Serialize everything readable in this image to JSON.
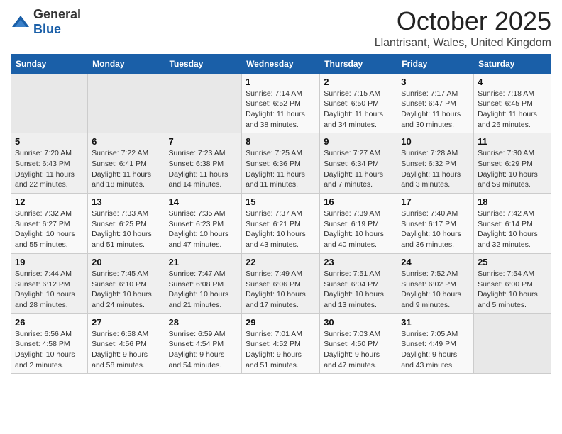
{
  "header": {
    "logo_general": "General",
    "logo_blue": "Blue",
    "title": "October 2025",
    "subtitle": "Llantrisant, Wales, United Kingdom"
  },
  "weekdays": [
    "Sunday",
    "Monday",
    "Tuesday",
    "Wednesday",
    "Thursday",
    "Friday",
    "Saturday"
  ],
  "weeks": [
    [
      {
        "day": "",
        "info": ""
      },
      {
        "day": "",
        "info": ""
      },
      {
        "day": "",
        "info": ""
      },
      {
        "day": "1",
        "info": "Sunrise: 7:14 AM\nSunset: 6:52 PM\nDaylight: 11 hours and 38 minutes."
      },
      {
        "day": "2",
        "info": "Sunrise: 7:15 AM\nSunset: 6:50 PM\nDaylight: 11 hours and 34 minutes."
      },
      {
        "day": "3",
        "info": "Sunrise: 7:17 AM\nSunset: 6:47 PM\nDaylight: 11 hours and 30 minutes."
      },
      {
        "day": "4",
        "info": "Sunrise: 7:18 AM\nSunset: 6:45 PM\nDaylight: 11 hours and 26 minutes."
      }
    ],
    [
      {
        "day": "5",
        "info": "Sunrise: 7:20 AM\nSunset: 6:43 PM\nDaylight: 11 hours and 22 minutes."
      },
      {
        "day": "6",
        "info": "Sunrise: 7:22 AM\nSunset: 6:41 PM\nDaylight: 11 hours and 18 minutes."
      },
      {
        "day": "7",
        "info": "Sunrise: 7:23 AM\nSunset: 6:38 PM\nDaylight: 11 hours and 14 minutes."
      },
      {
        "day": "8",
        "info": "Sunrise: 7:25 AM\nSunset: 6:36 PM\nDaylight: 11 hours and 11 minutes."
      },
      {
        "day": "9",
        "info": "Sunrise: 7:27 AM\nSunset: 6:34 PM\nDaylight: 11 hours and 7 minutes."
      },
      {
        "day": "10",
        "info": "Sunrise: 7:28 AM\nSunset: 6:32 PM\nDaylight: 11 hours and 3 minutes."
      },
      {
        "day": "11",
        "info": "Sunrise: 7:30 AM\nSunset: 6:29 PM\nDaylight: 10 hours and 59 minutes."
      }
    ],
    [
      {
        "day": "12",
        "info": "Sunrise: 7:32 AM\nSunset: 6:27 PM\nDaylight: 10 hours and 55 minutes."
      },
      {
        "day": "13",
        "info": "Sunrise: 7:33 AM\nSunset: 6:25 PM\nDaylight: 10 hours and 51 minutes."
      },
      {
        "day": "14",
        "info": "Sunrise: 7:35 AM\nSunset: 6:23 PM\nDaylight: 10 hours and 47 minutes."
      },
      {
        "day": "15",
        "info": "Sunrise: 7:37 AM\nSunset: 6:21 PM\nDaylight: 10 hours and 43 minutes."
      },
      {
        "day": "16",
        "info": "Sunrise: 7:39 AM\nSunset: 6:19 PM\nDaylight: 10 hours and 40 minutes."
      },
      {
        "day": "17",
        "info": "Sunrise: 7:40 AM\nSunset: 6:17 PM\nDaylight: 10 hours and 36 minutes."
      },
      {
        "day": "18",
        "info": "Sunrise: 7:42 AM\nSunset: 6:14 PM\nDaylight: 10 hours and 32 minutes."
      }
    ],
    [
      {
        "day": "19",
        "info": "Sunrise: 7:44 AM\nSunset: 6:12 PM\nDaylight: 10 hours and 28 minutes."
      },
      {
        "day": "20",
        "info": "Sunrise: 7:45 AM\nSunset: 6:10 PM\nDaylight: 10 hours and 24 minutes."
      },
      {
        "day": "21",
        "info": "Sunrise: 7:47 AM\nSunset: 6:08 PM\nDaylight: 10 hours and 21 minutes."
      },
      {
        "day": "22",
        "info": "Sunrise: 7:49 AM\nSunset: 6:06 PM\nDaylight: 10 hours and 17 minutes."
      },
      {
        "day": "23",
        "info": "Sunrise: 7:51 AM\nSunset: 6:04 PM\nDaylight: 10 hours and 13 minutes."
      },
      {
        "day": "24",
        "info": "Sunrise: 7:52 AM\nSunset: 6:02 PM\nDaylight: 10 hours and 9 minutes."
      },
      {
        "day": "25",
        "info": "Sunrise: 7:54 AM\nSunset: 6:00 PM\nDaylight: 10 hours and 5 minutes."
      }
    ],
    [
      {
        "day": "26",
        "info": "Sunrise: 6:56 AM\nSunset: 4:58 PM\nDaylight: 10 hours and 2 minutes."
      },
      {
        "day": "27",
        "info": "Sunrise: 6:58 AM\nSunset: 4:56 PM\nDaylight: 9 hours and 58 minutes."
      },
      {
        "day": "28",
        "info": "Sunrise: 6:59 AM\nSunset: 4:54 PM\nDaylight: 9 hours and 54 minutes."
      },
      {
        "day": "29",
        "info": "Sunrise: 7:01 AM\nSunset: 4:52 PM\nDaylight: 9 hours and 51 minutes."
      },
      {
        "day": "30",
        "info": "Sunrise: 7:03 AM\nSunset: 4:50 PM\nDaylight: 9 hours and 47 minutes."
      },
      {
        "day": "31",
        "info": "Sunrise: 7:05 AM\nSunset: 4:49 PM\nDaylight: 9 hours and 43 minutes."
      },
      {
        "day": "",
        "info": ""
      }
    ]
  ]
}
